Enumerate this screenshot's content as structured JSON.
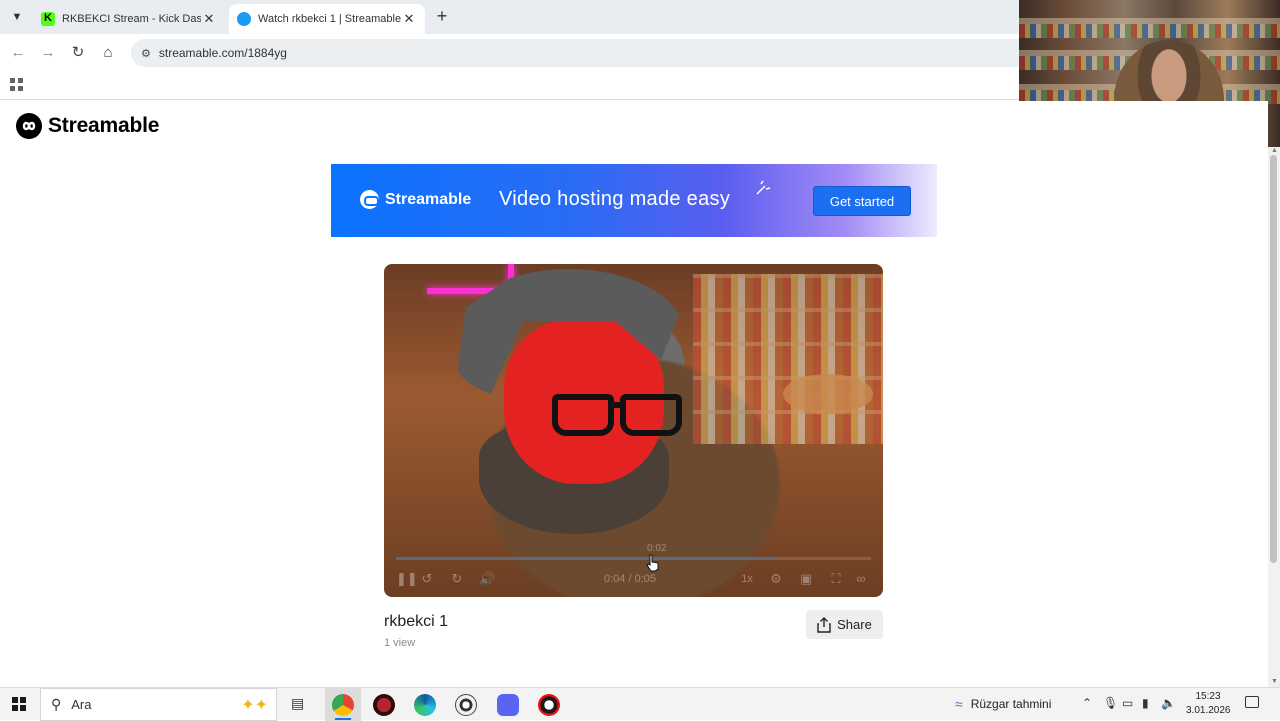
{
  "browser": {
    "tabs": [
      {
        "title": "RKBEKCI Stream - Kick Dashboa",
        "favicon": "kick-icon"
      },
      {
        "title": "Watch rkbekci 1 | Streamable",
        "favicon": "streamable-icon",
        "active": true
      }
    ],
    "url": "streamable.com/1884yg"
  },
  "site": {
    "logo_text": "Streamable"
  },
  "banner": {
    "brand": "Streamable",
    "tagline": "Video hosting made easy",
    "cta_label": "Get started",
    "colors": {
      "start": "#0a73ff",
      "end": "#ecebfd"
    }
  },
  "player": {
    "hover_time": "0:02",
    "time_display": "0:04 / 0:05",
    "progress": 0.8,
    "speed_label": "1x"
  },
  "video": {
    "title": "rkbekci 1",
    "views": "1 view",
    "share_label": "Share"
  },
  "taskbar": {
    "search_placeholder": "Ara",
    "weather": "Rüzgar tahmini",
    "time": "15:23",
    "date": "3.01.2026"
  }
}
